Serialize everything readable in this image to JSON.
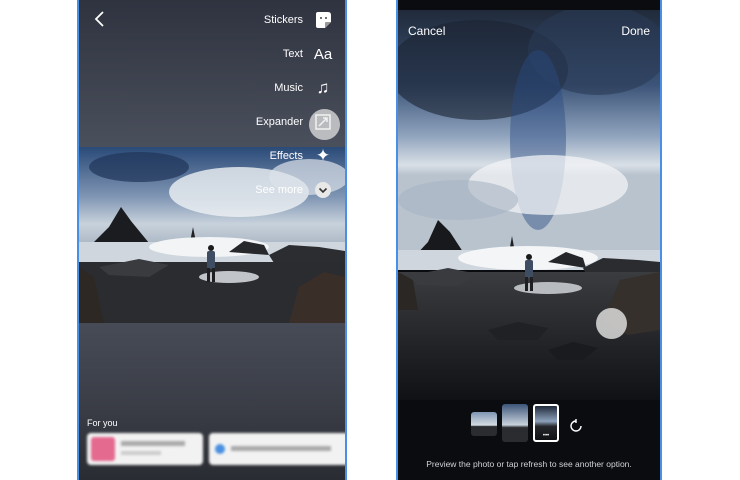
{
  "left": {
    "tools": [
      {
        "label": "Stickers",
        "icon": "sticker-icon"
      },
      {
        "label": "Text",
        "icon": "text-aa-icon",
        "glyph": "Aa"
      },
      {
        "label": "Music",
        "icon": "music-note-icon",
        "glyph": "♫"
      },
      {
        "label": "Expander",
        "icon": "expander-icon"
      },
      {
        "label": "Effects",
        "icon": "sparkle-icon",
        "glyph": "✦"
      },
      {
        "label": "See more",
        "icon": "chevron-down-icon"
      }
    ],
    "for_you": "For you"
  },
  "right": {
    "cancel": "Cancel",
    "done": "Done",
    "caption": "Preview the photo or tap refresh to see another option.",
    "thumb_more": "•••"
  },
  "colors": {
    "accent_border": "#4a8fe7"
  }
}
